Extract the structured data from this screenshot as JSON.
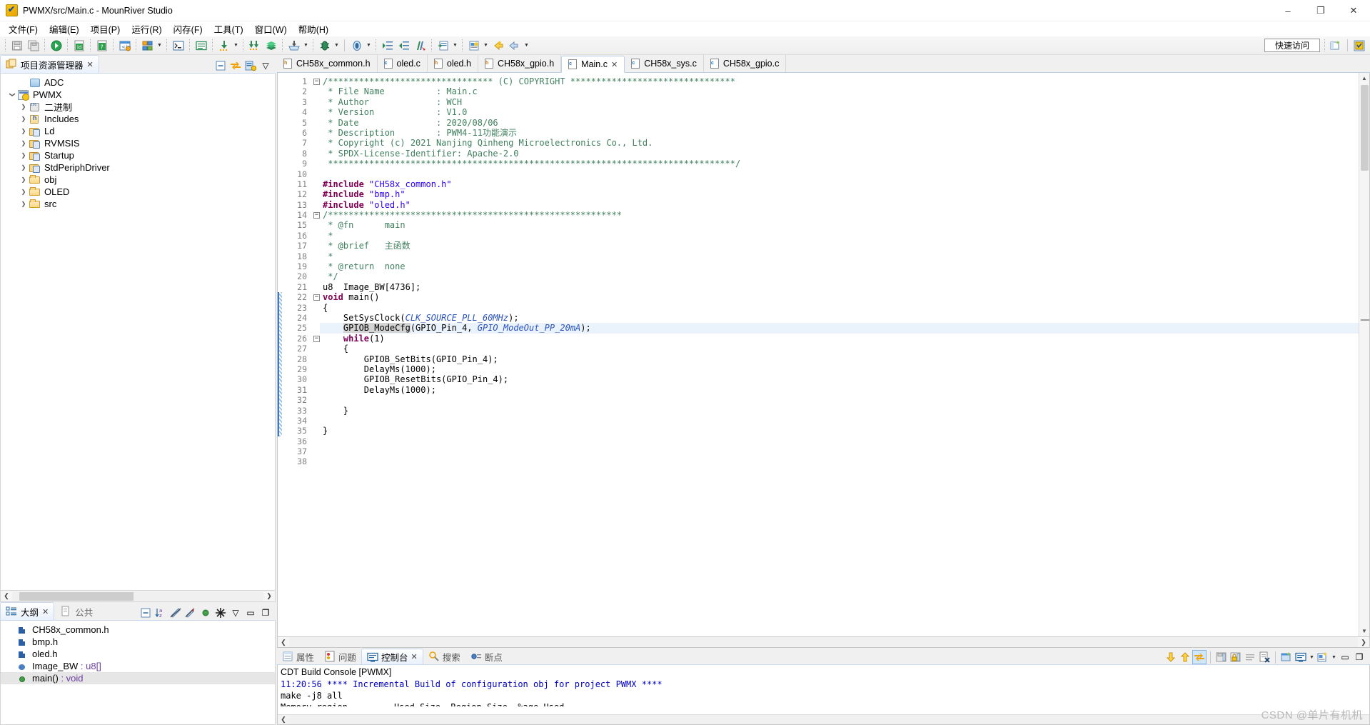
{
  "window": {
    "title": "PWMX/src/Main.c - MounRiver Studio",
    "logo_icon": "mounriver-logo-icon",
    "buttons": {
      "minimize": "–",
      "maximize": "❐",
      "close": "✕"
    }
  },
  "menubar": {
    "items": [
      "文件(F)",
      "编辑(E)",
      "项目(P)",
      "运行(R)",
      "闪存(F)",
      "工具(T)",
      "窗口(W)",
      "帮助(H)"
    ]
  },
  "toolbar": {
    "quick_access": "快速访问",
    "icons": [
      "save-icon",
      "save-all-icon",
      "build-project-icon",
      "link-database-icon",
      "help-info-icon",
      "web-config-icon",
      "component-icon",
      "component-dropdown-icon",
      "terminal-icon",
      "console-icon",
      "download-icon",
      "download-dropdown-icon",
      "download-all-icon",
      "library-icon",
      "import-icon",
      "import-dropdown-icon",
      "debug-icon",
      "debug-dropdown-icon",
      "run-icon",
      "run-dropdown-icon",
      "indent-right-icon",
      "indent-left-icon",
      "format-code-icon",
      "new-file-icon",
      "new-file-dropdown-icon",
      "new-wizard-icon",
      "new-wizard-dropdown-icon",
      "back-icon",
      "forward-icon",
      "forward-dropdown-icon"
    ],
    "right_icons": [
      "new-perspective-icon",
      "perspective-mounriver-icon"
    ]
  },
  "project_explorer": {
    "tab_label": "项目资源管理器",
    "tab_close": "✕",
    "tools": [
      "collapse-all-icon",
      "link-with-editor-icon",
      "view-menu-icon",
      "chevron-down-icon"
    ],
    "tree": [
      {
        "label": "ADC",
        "indent": 1,
        "twisty": "none",
        "icon": "closed-project-icon"
      },
      {
        "label": "PWMX",
        "indent": 0,
        "twisty": "down",
        "icon": "open-project-icon"
      },
      {
        "label": "二进制",
        "indent": 1,
        "twisty": "right",
        "icon": "binaries-icon"
      },
      {
        "label": "Includes",
        "indent": 1,
        "twisty": "right",
        "icon": "includes-icon"
      },
      {
        "label": "Ld",
        "indent": 1,
        "twisty": "right",
        "icon": "source-folder-icon"
      },
      {
        "label": "RVMSIS",
        "indent": 1,
        "twisty": "right",
        "icon": "source-folder-icon"
      },
      {
        "label": "Startup",
        "indent": 1,
        "twisty": "right",
        "icon": "source-folder-icon"
      },
      {
        "label": "StdPeriphDriver",
        "indent": 1,
        "twisty": "right",
        "icon": "source-folder-icon"
      },
      {
        "label": "obj",
        "indent": 1,
        "twisty": "right",
        "icon": "folder-icon"
      },
      {
        "label": "OLED",
        "indent": 1,
        "twisty": "right",
        "icon": "folder-icon"
      },
      {
        "label": "src",
        "indent": 1,
        "twisty": "right",
        "icon": "folder-icon"
      }
    ]
  },
  "outline": {
    "tabs": [
      {
        "label": "大纲",
        "active": true,
        "close": "✕",
        "icon": "outline-icon"
      },
      {
        "label": "公共",
        "active": false,
        "icon": "public-icon"
      }
    ],
    "tools": [
      "collapse-all-icon",
      "sort-az-icon",
      "hide-fields-icon",
      "hide-static-icon",
      "hide-nonpublic-icon",
      "focus-icon",
      "view-menu-icon",
      "minimize-icon",
      "maximize-icon"
    ],
    "items": [
      {
        "label": "CH58x_common.h",
        "icon": "header-include-icon",
        "type": ""
      },
      {
        "label": "bmp.h",
        "icon": "header-include-icon",
        "type": ""
      },
      {
        "label": "oled.h",
        "icon": "header-include-icon",
        "type": ""
      },
      {
        "label": "Image_BW",
        "icon": "variable-icon",
        "type": " : u8[]"
      },
      {
        "label": "main()",
        "icon": "function-icon",
        "type": " : void",
        "selected": true
      }
    ]
  },
  "editor": {
    "tabs": [
      {
        "label": "CH58x_common.h",
        "kind": "h",
        "active": false
      },
      {
        "label": "oled.c",
        "kind": "c",
        "active": false
      },
      {
        "label": "oled.h",
        "kind": "h",
        "active": false
      },
      {
        "label": "CH58x_gpio.h",
        "kind": "h",
        "active": false
      },
      {
        "label": "Main.c",
        "kind": "c",
        "active": true,
        "close": "✕"
      },
      {
        "label": "CH58x_sys.c",
        "kind": "c",
        "active": false
      },
      {
        "label": "CH58x_gpio.c",
        "kind": "c",
        "active": false
      }
    ],
    "lines": [
      {
        "n": 1,
        "fold": true,
        "text": "/******************************** (C) COPYRIGHT ********************************"
      },
      {
        "n": 2,
        "fold": false,
        "text": " * File Name          : Main.c"
      },
      {
        "n": 3,
        "fold": false,
        "text": " * Author             : WCH"
      },
      {
        "n": 4,
        "fold": false,
        "text": " * Version            : V1.0"
      },
      {
        "n": 5,
        "fold": false,
        "text": " * Date               : 2020/08/06"
      },
      {
        "n": 6,
        "fold": false,
        "text": " * Description        : PWM4-11功能演示"
      },
      {
        "n": 7,
        "fold": false,
        "text": " * Copyright (c) 2021 Nanjing Qinheng Microelectronics Co., Ltd."
      },
      {
        "n": 8,
        "fold": false,
        "text": " * SPDX-License-Identifier: Apache-2.0"
      },
      {
        "n": 9,
        "fold": false,
        "text": " *******************************************************************************/"
      },
      {
        "n": 10,
        "fold": false,
        "text": ""
      },
      {
        "n": 11,
        "fold": false,
        "text": "#include \"CH58x_common.h\""
      },
      {
        "n": 12,
        "fold": false,
        "text": "#include \"bmp.h\""
      },
      {
        "n": 13,
        "fold": false,
        "text": "#include \"oled.h\""
      },
      {
        "n": 14,
        "fold": true,
        "text": "/*********************************************************"
      },
      {
        "n": 15,
        "fold": false,
        "text": " * @fn      main"
      },
      {
        "n": 16,
        "fold": false,
        "text": " *"
      },
      {
        "n": 17,
        "fold": false,
        "text": " * @brief   主函数"
      },
      {
        "n": 18,
        "fold": false,
        "text": " *"
      },
      {
        "n": 19,
        "fold": false,
        "text": " * @return  none"
      },
      {
        "n": 20,
        "fold": false,
        "text": " */"
      },
      {
        "n": 21,
        "fold": false,
        "text": "u8  Image_BW[4736];"
      },
      {
        "n": 22,
        "fold": true,
        "text": "void main()"
      },
      {
        "n": 23,
        "fold": false,
        "text": "{"
      },
      {
        "n": 24,
        "fold": false,
        "text": "    SetSysClock(CLK_SOURCE_PLL_60MHz);"
      },
      {
        "n": 25,
        "fold": false,
        "text": "    GPIOB_ModeCfg(GPIO_Pin_4, GPIO_ModeOut_PP_20mA);",
        "highlight": true
      },
      {
        "n": 26,
        "fold": true,
        "text": "    while(1)"
      },
      {
        "n": 27,
        "fold": false,
        "text": "    {"
      },
      {
        "n": 28,
        "fold": false,
        "text": "        GPIOB_SetBits(GPIO_Pin_4);"
      },
      {
        "n": 29,
        "fold": false,
        "text": "        DelayMs(1000);"
      },
      {
        "n": 30,
        "fold": false,
        "text": "        GPIOB_ResetBits(GPIO_Pin_4);"
      },
      {
        "n": 31,
        "fold": false,
        "text": "        DelayMs(1000);"
      },
      {
        "n": 32,
        "fold": false,
        "text": ""
      },
      {
        "n": 33,
        "fold": false,
        "text": "    }"
      },
      {
        "n": 34,
        "fold": false,
        "text": ""
      },
      {
        "n": 35,
        "fold": false,
        "text": "}"
      },
      {
        "n": 36,
        "fold": false,
        "text": ""
      },
      {
        "n": 37,
        "fold": false,
        "text": ""
      },
      {
        "n": 38,
        "fold": false,
        "text": ""
      }
    ]
  },
  "console": {
    "tabs": [
      {
        "label": "属性",
        "active": false,
        "icon": "properties-icon"
      },
      {
        "label": "问题",
        "active": false,
        "icon": "problems-icon"
      },
      {
        "label": "控制台",
        "active": true,
        "close": "✕",
        "icon": "console-icon"
      },
      {
        "label": "搜索",
        "active": false,
        "icon": "search-icon"
      },
      {
        "label": "断点",
        "active": false,
        "icon": "breakpoints-icon"
      }
    ],
    "tools": [
      "scroll-down-icon",
      "scroll-up-icon",
      "scroll-lock-icon",
      "save-console-icon",
      "lock-console-icon",
      "clear-console-icon",
      "remove-console-icon",
      "open-console-icon",
      "display-console-icon",
      "display-console-dropdown-icon",
      "new-console-icon",
      "new-console-dropdown-icon",
      "minimize-icon",
      "maximize-icon"
    ],
    "title": "CDT Build Console [PWMX]",
    "output": [
      {
        "text": "11:20:56 **** Incremental Build of configuration obj for project PWMX ****",
        "color": "blue"
      },
      {
        "text": "make -j8 all",
        "color": "black"
      },
      {
        "text": "Memory region         Used Size  Region Size  %age Used",
        "color": "black"
      }
    ]
  },
  "watermark": "CSDN @单片有机机"
}
